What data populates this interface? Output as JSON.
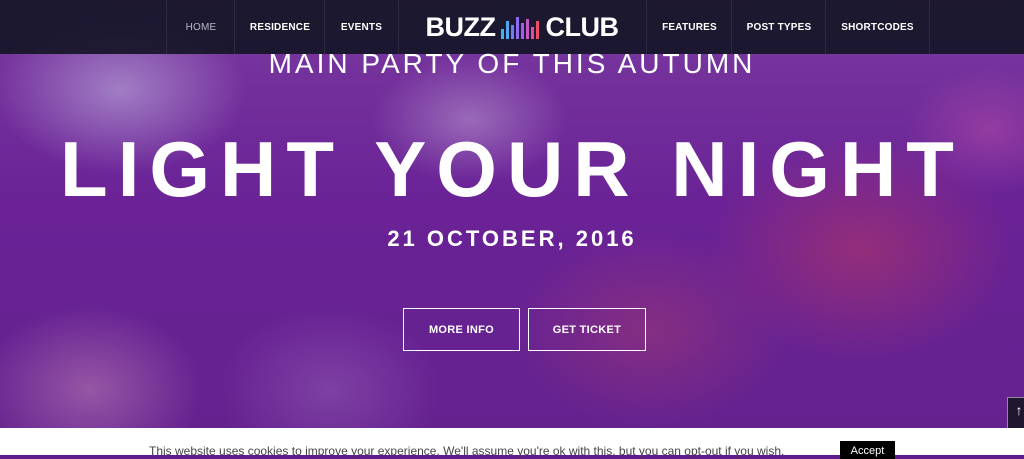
{
  "nav": {
    "left_items": [
      {
        "label": "HOME",
        "active": true
      },
      {
        "label": "RESIDENCE"
      },
      {
        "label": "EVENTS"
      }
    ],
    "right_items": [
      {
        "label": "FEATURES"
      },
      {
        "label": "POST TYPES"
      },
      {
        "label": "SHORTCODES"
      }
    ],
    "logo": {
      "word1": "BUZZ",
      "word2": "CLUB",
      "icon": "equalizer-bars-icon"
    }
  },
  "hero": {
    "eyebrow": "MAIN PARTY OF THIS AUTUMN",
    "headline": "LIGHT YOUR NIGHT",
    "date": "21 OCTOBER, 2016",
    "buttons": {
      "more_info": "MORE INFO",
      "get_ticket": "GET TICKET"
    }
  },
  "scroll_top": {
    "icon": "arrow-up-icon",
    "glyph": "↑"
  },
  "cookie": {
    "text": "This website uses cookies to improve your experience. We'll assume you're ok with this, but you can opt-out if you wish.",
    "accept": "Accept"
  },
  "colors": {
    "navbar": "#161628",
    "hero_purple": "#6a2296",
    "logo_bars": [
      "#3db4f2",
      "#6b7cf5",
      "#a35cf2",
      "#e0509a",
      "#f04d6a"
    ]
  }
}
